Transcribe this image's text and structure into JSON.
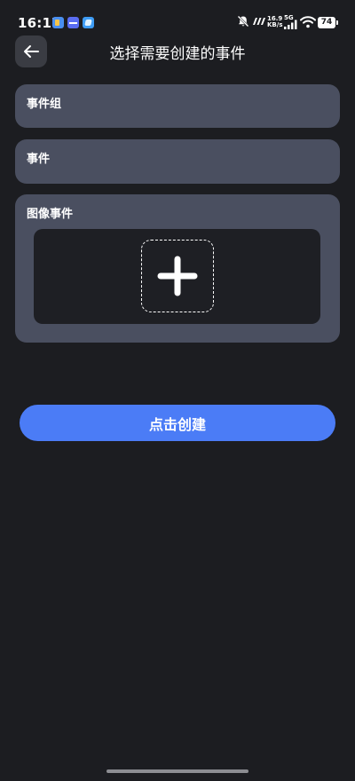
{
  "status_bar": {
    "time": "16:17",
    "network_speed_value": "16.9",
    "network_speed_unit": "KB/s",
    "network_type": "5G",
    "battery_level": "74",
    "icons": [
      "app-notification-icon",
      "app-notification-icon",
      "app-notification-icon",
      "bell-off-icon",
      "hd-icon",
      "signal-icon",
      "wifi-icon",
      "battery-icon"
    ]
  },
  "header": {
    "title": "选择需要创建的事件",
    "back_icon": "arrow-left-icon"
  },
  "form": {
    "event_group_label": "事件组",
    "event_label": "事件",
    "image_event_label": "图像事件",
    "add_icon": "plus-icon"
  },
  "actions": {
    "create_label": "点击创建",
    "create_color": "#4b7cf6"
  },
  "colors": {
    "background": "#1c1d21",
    "card": "#4a4f60",
    "image_area": "#1e1f24"
  }
}
